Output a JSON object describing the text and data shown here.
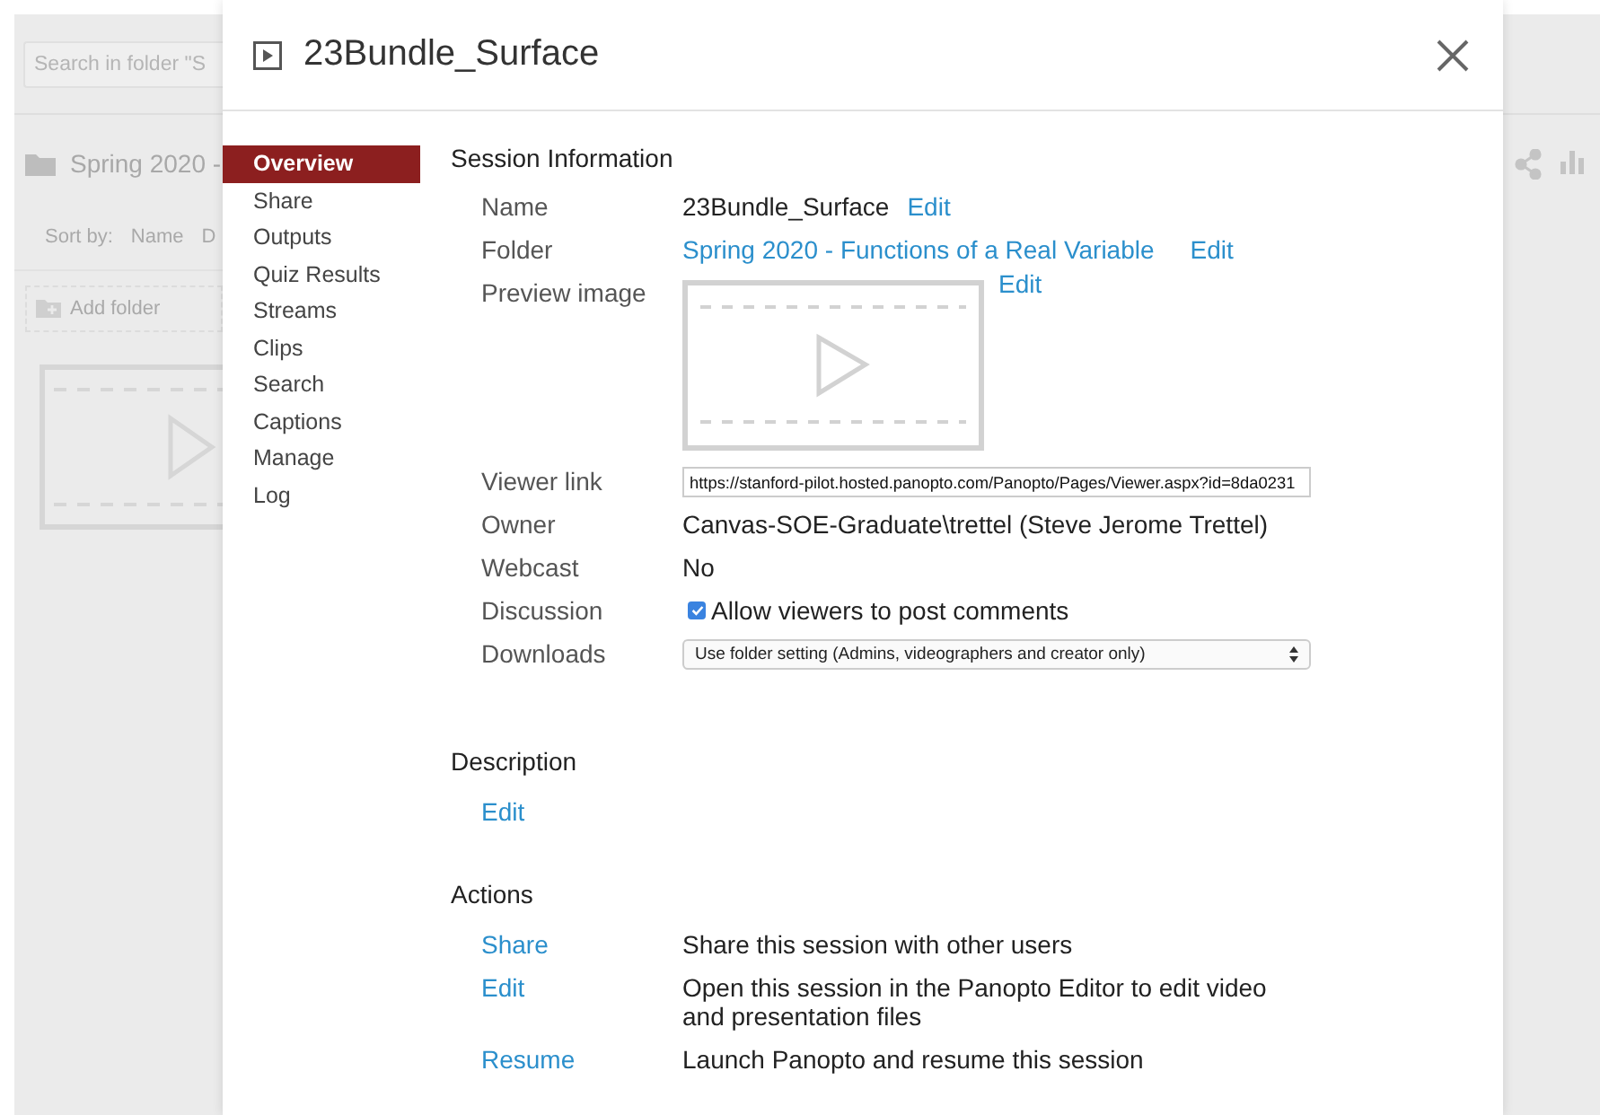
{
  "background": {
    "search": {
      "placeholder": "Search in folder \"S"
    },
    "folder_title": "Spring 2020 -",
    "sort_label": "Sort by:",
    "sort_options": [
      "Name",
      "D"
    ],
    "add_folder": "Add folder"
  },
  "dialog": {
    "title": "23Bundle_Surface",
    "nav": [
      {
        "label": "Overview",
        "selected": true
      },
      {
        "label": "Share",
        "selected": false
      },
      {
        "label": "Outputs",
        "selected": false
      },
      {
        "label": "Quiz Results",
        "selected": false
      },
      {
        "label": "Streams",
        "selected": false
      },
      {
        "label": "Clips",
        "selected": false
      },
      {
        "label": "Search",
        "selected": false
      },
      {
        "label": "Captions",
        "selected": false
      },
      {
        "label": "Manage",
        "selected": false
      },
      {
        "label": "Log",
        "selected": false
      }
    ],
    "session_information": {
      "heading": "Session Information",
      "name": {
        "label": "Name",
        "value": "23Bundle_Surface",
        "edit": "Edit"
      },
      "folder": {
        "label": "Folder",
        "value": "Spring 2020 - Functions of a Real Variable",
        "edit": "Edit"
      },
      "preview_image": {
        "label": "Preview image",
        "edit": "Edit"
      },
      "viewer_link": {
        "label": "Viewer link",
        "value": "https://stanford-pilot.hosted.panopto.com/Panopto/Pages/Viewer.aspx?id=8da0231"
      },
      "owner": {
        "label": "Owner",
        "value": "Canvas-SOE-Graduate\\trettel (Steve Jerome Trettel)"
      },
      "webcast": {
        "label": "Webcast",
        "value": "No"
      },
      "discussion": {
        "label": "Discussion",
        "checkbox_label": "Allow viewers to post comments",
        "checked": true
      },
      "downloads": {
        "label": "Downloads",
        "value": "Use folder setting (Admins, videographers and creator only)"
      }
    },
    "description": {
      "heading": "Description",
      "edit": "Edit"
    },
    "actions": {
      "heading": "Actions",
      "items": [
        {
          "link": "Share",
          "text": "Share this session with other users"
        },
        {
          "link": "Edit",
          "text": "Open this session in the Panopto Editor to edit video and presentation files"
        },
        {
          "link": "Resume",
          "text": "Launch Panopto and resume this session"
        }
      ]
    }
  }
}
